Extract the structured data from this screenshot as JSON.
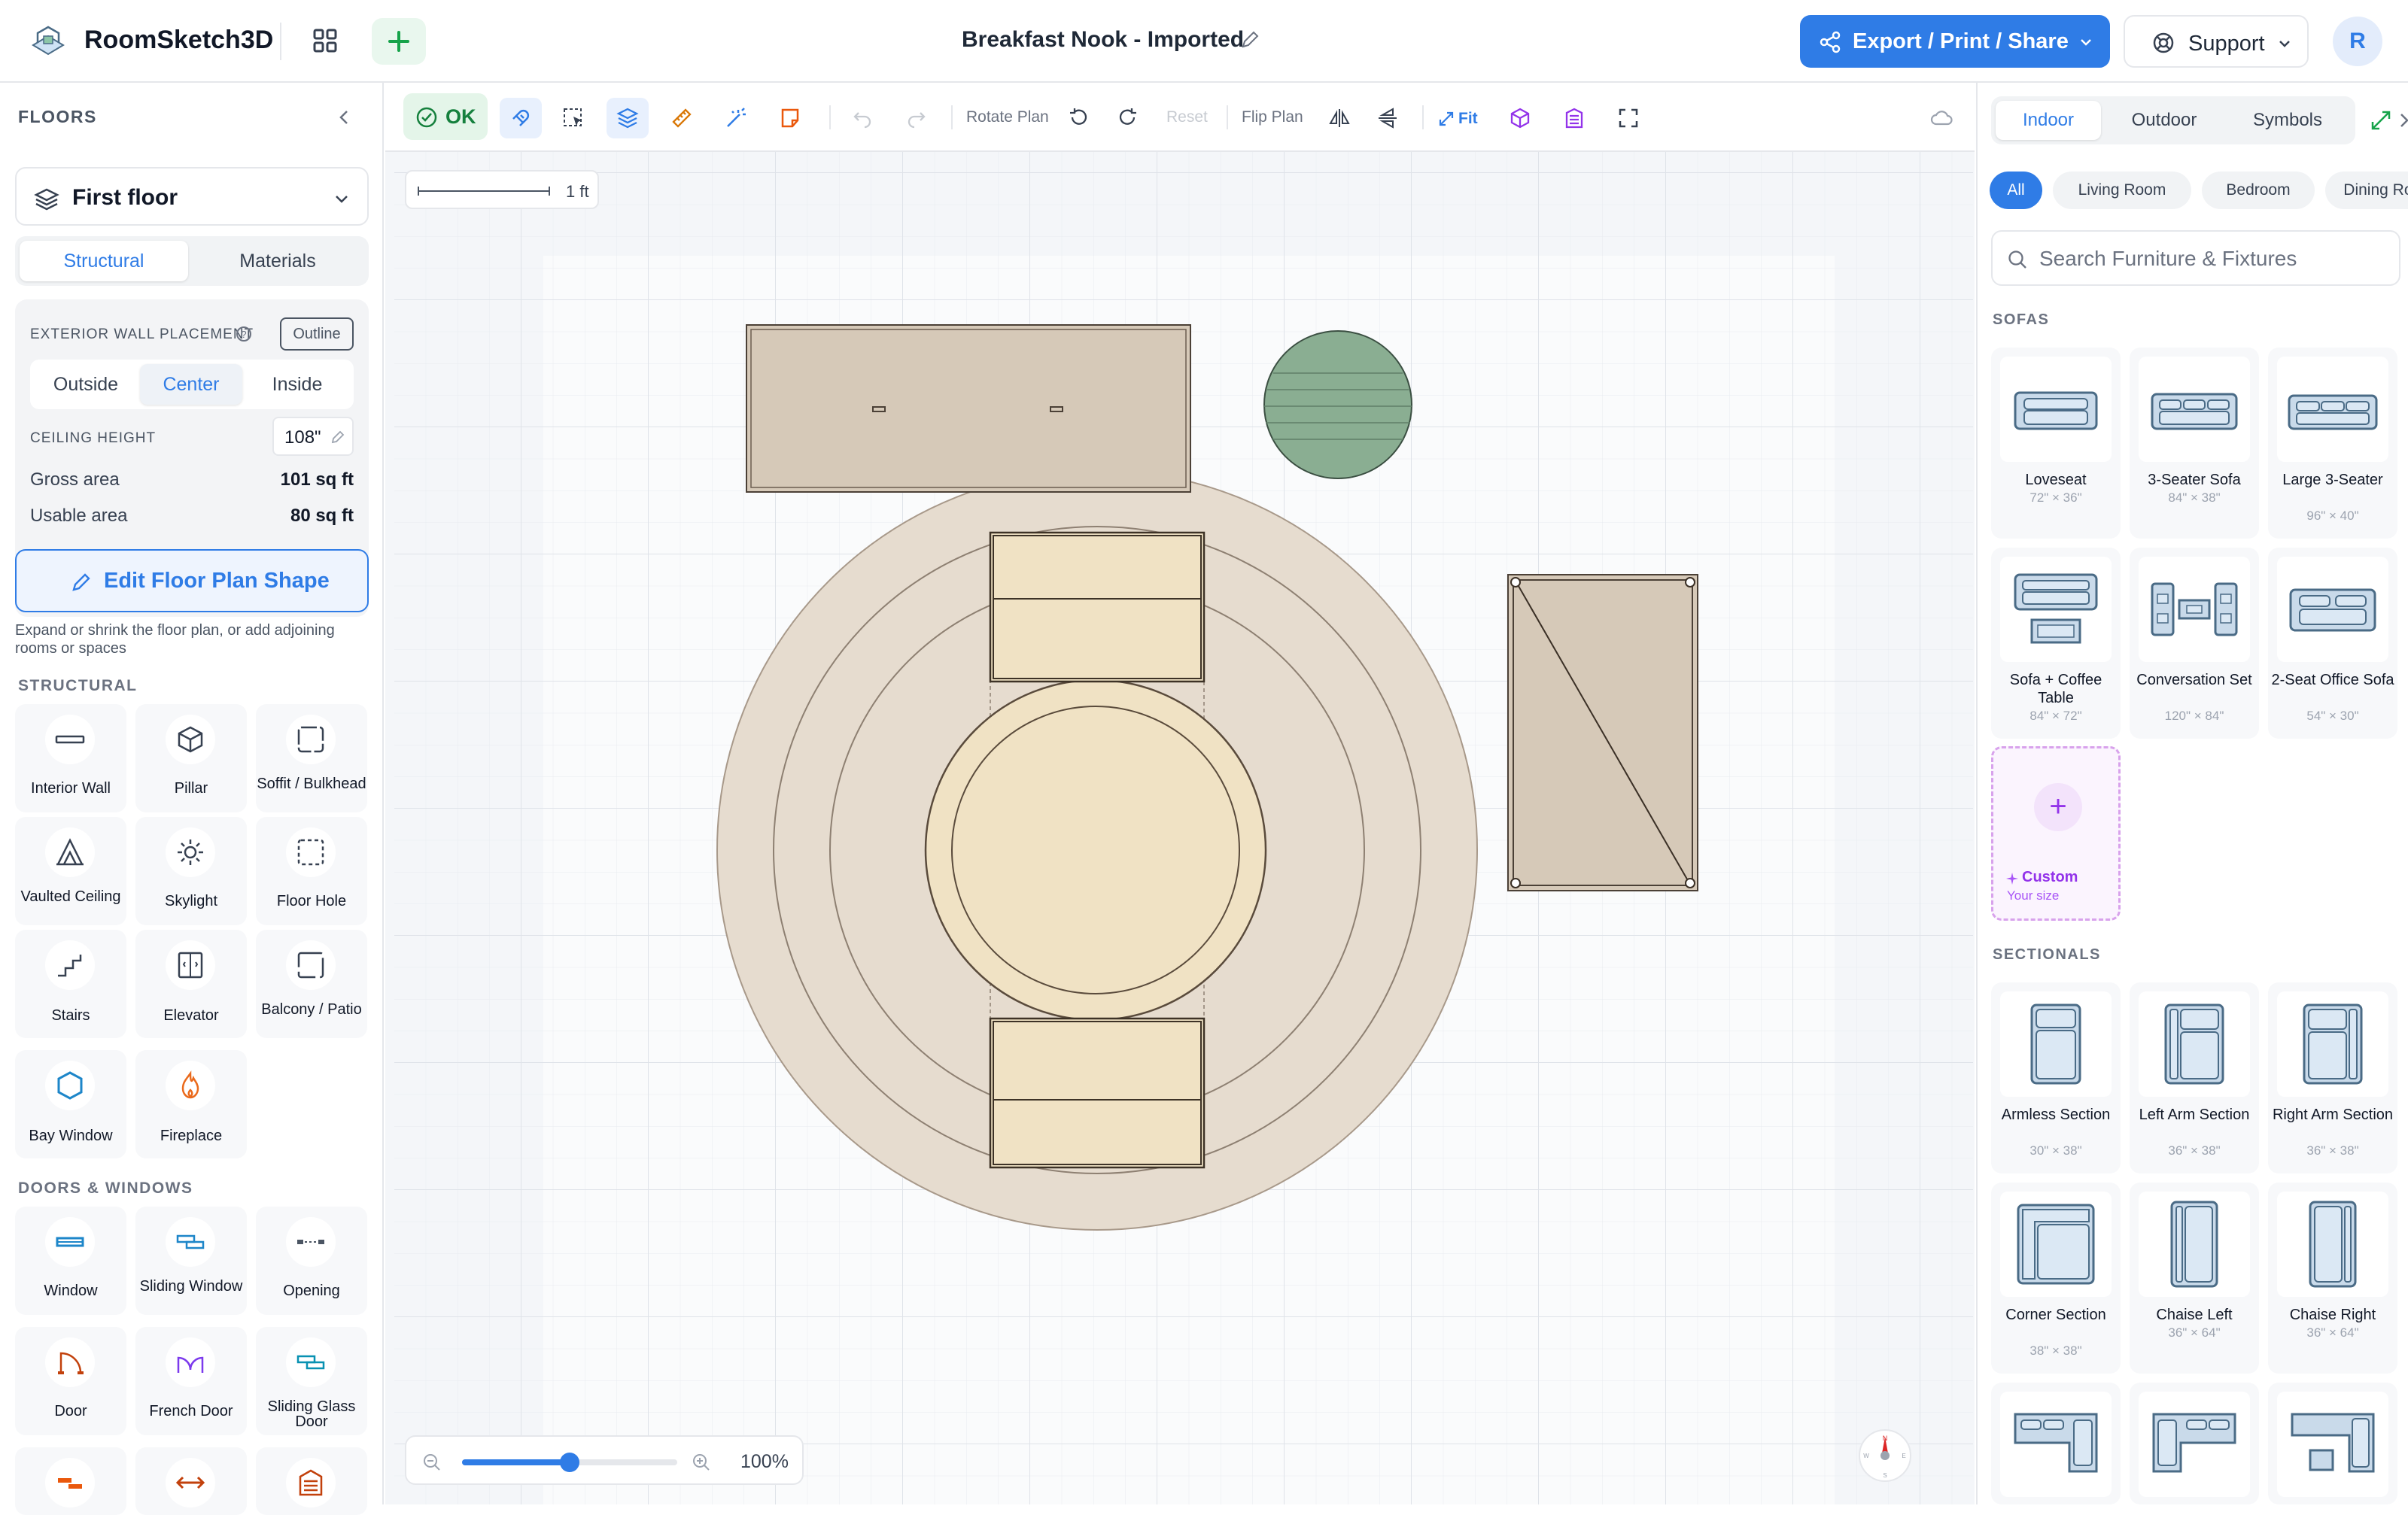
{
  "app": {
    "name": "RoomSketch3D",
    "document_title": "Breakfast Nook - Imported"
  },
  "topbar": {
    "export_label": "Export / Print / Share",
    "support_label": "Support",
    "avatar_initial": "R"
  },
  "left": {
    "floors_title": "FLOORS",
    "floor_selected": "First floor",
    "tabs": [
      "Structural",
      "Materials"
    ],
    "active_tab": "Structural",
    "wall_placement_label": "EXTERIOR WALL PLACEMENT",
    "outline_label": "Outline",
    "placement_options": [
      "Outside",
      "Center",
      "Inside"
    ],
    "placement_active": "Center",
    "ceiling_label": "CEILING HEIGHT",
    "ceiling_value": "108\"",
    "gross_label": "Gross area",
    "gross_value": "101 sq ft",
    "usable_label": "Usable area",
    "usable_value": "80 sq ft",
    "edit_shape_label": "Edit Floor Plan Shape",
    "edit_shape_help": "Expand or shrink the floor plan, or add adjoining rooms or spaces",
    "structural_title": "STRUCTURAL",
    "structural_items": [
      {
        "label": "Interior Wall",
        "icon": "interior-wall-icon"
      },
      {
        "label": "Pillar",
        "icon": "pillar-icon"
      },
      {
        "label": "Soffit / Bulkhead",
        "icon": "soffit-icon"
      },
      {
        "label": "Vaulted Ceiling",
        "icon": "vaulted-ceiling-icon"
      },
      {
        "label": "Skylight",
        "icon": "skylight-icon"
      },
      {
        "label": "Floor Hole",
        "icon": "floor-hole-icon"
      },
      {
        "label": "Stairs",
        "icon": "stairs-icon"
      },
      {
        "label": "Elevator",
        "icon": "elevator-icon"
      },
      {
        "label": "Balcony / Patio",
        "icon": "balcony-icon"
      },
      {
        "label": "Bay Window",
        "icon": "bay-window-icon"
      },
      {
        "label": "Fireplace",
        "icon": "fireplace-icon"
      }
    ],
    "doors_title": "DOORS & WINDOWS",
    "door_items": [
      {
        "label": "Window",
        "icon": "window-icon"
      },
      {
        "label": "Sliding Window",
        "icon": "sliding-window-icon"
      },
      {
        "label": "Opening",
        "icon": "opening-icon"
      },
      {
        "label": "Door",
        "icon": "door-icon"
      },
      {
        "label": "French Door",
        "icon": "french-door-icon"
      },
      {
        "label": "Sliding Glass Door",
        "icon": "sliding-glass-door-icon"
      }
    ]
  },
  "toolbar": {
    "ok_label": "OK",
    "rotate_label": "Rotate Plan",
    "reset_label": "Reset",
    "flip_label": "Flip Plan",
    "fit_label": "Fit"
  },
  "canvas": {
    "scale_label": "1 ft",
    "zoom_label": "100%",
    "zoom_level": 0.5,
    "compass_letters": [
      "N",
      "E",
      "S",
      "W"
    ]
  },
  "right": {
    "tabs": [
      "Indoor",
      "Outdoor",
      "Symbols"
    ],
    "active_tab": "Indoor",
    "chips": [
      "All",
      "Living Room",
      "Bedroom",
      "Dining Room"
    ],
    "active_chip": "All",
    "search_placeholder": "Search Furniture & Fixtures",
    "sofas_title": "SOFAS",
    "sofas": [
      {
        "name": "Loveseat",
        "size": "72\" × 36\""
      },
      {
        "name": "3-Seater Sofa",
        "size": "84\" × 38\""
      },
      {
        "name": "Large 3-Seater",
        "size": "96\" × 40\""
      },
      {
        "name": "Sofa + Coffee Table",
        "size": "84\" × 72\""
      },
      {
        "name": "Conversation Set",
        "size": "120\" × 84\""
      },
      {
        "name": "2-Seat Office Sofa",
        "size": "54\" × 30\""
      }
    ],
    "custom_label": "Custom",
    "custom_sub": "Your size",
    "sectionals_title": "SECTIONALS",
    "sectionals": [
      {
        "name": "Armless Section",
        "size": "30\" × 38\""
      },
      {
        "name": "Left Arm Section",
        "size": "36\" × 38\""
      },
      {
        "name": "Right Arm Section",
        "size": "36\" × 38\""
      },
      {
        "name": "Corner Section",
        "size": "38\" × 38\""
      },
      {
        "name": "Chaise Left",
        "size": "36\" × 64\""
      },
      {
        "name": "Chaise Right",
        "size": "36\" × 64\""
      }
    ]
  },
  "colors": {
    "accent": "#2f7ce6",
    "ok_green": "#15803d",
    "rug": "#e6dccf",
    "table": "#f0e2c4",
    "console": "#d6c9b8",
    "plant": "#8aae92",
    "custom_purple": "#9333ea"
  }
}
